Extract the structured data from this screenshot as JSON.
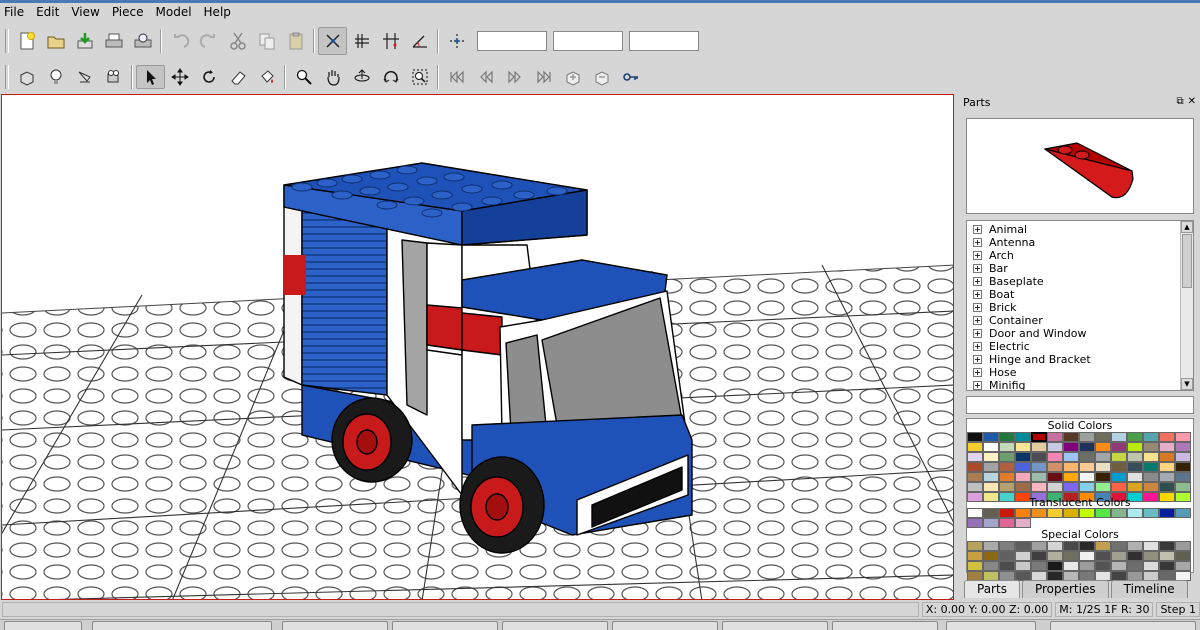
{
  "menu": [
    "File",
    "Edit",
    "View",
    "Piece",
    "Model",
    "Help"
  ],
  "toolbar1": {
    "buttons": [
      "new-icon",
      "open-icon",
      "save-icon",
      "print-icon",
      "print-preview-icon",
      "undo-icon",
      "redo-icon",
      "cut-icon",
      "copy-icon",
      "paste-icon",
      "snap-xy-icon",
      "snap-z-icon",
      "snap-grid-icon",
      "snap-angle-icon",
      "lock-icon"
    ],
    "coord_x": "",
    "coord_y": "",
    "coord_z": ""
  },
  "toolbar2": {
    "buttons": [
      "new-piece-icon",
      "light-icon",
      "spotlight-icon",
      "camera-icon",
      "select-icon",
      "move-icon",
      "rotate-icon",
      "erase-icon",
      "paint-icon",
      "zoom-icon",
      "pan-icon",
      "orbit-icon",
      "roll-icon",
      "zoom-region-icon",
      "first-step-icon",
      "previous-step-icon",
      "next-step-icon",
      "last-step-icon",
      "insert-step-icon",
      "remove-step-icon",
      "key-icon"
    ]
  },
  "parts_panel": {
    "title": "Parts",
    "categories": [
      "Animal",
      "Antenna",
      "Arch",
      "Bar",
      "Baseplate",
      "Boat",
      "Brick",
      "Container",
      "Door and Window",
      "Electric",
      "Hinge and Bracket",
      "Hose",
      "Minifig"
    ],
    "search_value": "",
    "solid_colors_label": "Solid Colors",
    "translucent_colors_label": "Translucent Colors",
    "special_colors_label": "Special Colors",
    "solid_colors": [
      "#101010",
      "#1e5aa8",
      "#237841",
      "#008b9a",
      "#b40000",
      "#c870a0",
      "#583927",
      "#9ba19d",
      "#6d6e5c",
      "#b4d2e3",
      "#4b9f4a",
      "#55a5af",
      "#f2705e",
      "#fc97ac",
      "#f5cd2f",
      "#ffffff",
      "#c2dab8",
      "#fbe696",
      "#e4cd9e",
      "#c9cae2",
      "#81007b",
      "#20325b",
      "#fe8a18",
      "#923978",
      "#bbe90b",
      "#958a73",
      "#e4adc8",
      "#ac78ba",
      "#e1d5ed",
      "#fff1c4",
      "#6e9d6e",
      "#0a3463",
      "#4d4c52",
      "#f785b1",
      "#9dc3f7",
      "#6c6e68",
      "#a0a5a9",
      "#c5d640",
      "#bdc6ad",
      "#f7e38f",
      "#d67923",
      "#cbb9e1",
      "#ac4a2c",
      "#a3a2a4",
      "#ad6140",
      "#4c61db",
      "#7396c8",
      "#d09168",
      "#fcb76d",
      "#ffc995",
      "#eadec3",
      "#705e3f",
      "#354e5a",
      "#0b7a6e",
      "#ffd67f",
      "#352100",
      "#aa7d55",
      "#b8d4e0",
      "#e07d2d",
      "#f6a9bb",
      "#a0bcac",
      "#6a0e15",
      "#ffa70b",
      "#f2f3f2",
      "#372100",
      "#009ece",
      "#e0e0e0",
      "#8a8a8a",
      "#a5a9b4",
      "#5e748c",
      "#c0c0c0",
      "#ffe6b4",
      "#b4a16e",
      "#9c6c48",
      "#ffb6c1",
      "#d3d3d3",
      "#7b68ee",
      "#87ceeb",
      "#90ee90",
      "#ff6347",
      "#daa520",
      "#cd853f",
      "#2f4f4f",
      "#8fbc8f",
      "#dda0dd",
      "#f0e68c",
      "#48d1cc",
      "#ff4500",
      "#9370db",
      "#3cb371",
      "#b22222",
      "#ff8c00",
      "#4682b4",
      "#dc143c",
      "#00ced1",
      "#ff1493",
      "#ffd700",
      "#adff2f"
    ],
    "translucent_colors": [
      "#fcfcfc",
      "#635f52",
      "#c91a09",
      "#ff800d",
      "#f08f1c",
      "#f5cd2f",
      "#dab000",
      "#c0ff00",
      "#56e646",
      "#84b68d",
      "#aee9ef",
      "#68bcc5",
      "#0020a0",
      "#559ab7",
      "#9670b8",
      "#a5a5cb",
      "#df6695",
      "#e4adc8"
    ],
    "special_colors": [
      "#b8a35c",
      "#aaaaaa",
      "#7e7e7e",
      "#5e5e5e",
      "#a0a0a0",
      "#d4d4d4",
      "#4a4a4a",
      "#2a2a2a",
      "#c0a050",
      "#707070",
      "#b0b0b0",
      "#e0e0e0",
      "#3a3a3a",
      "#9a9a9a",
      "#c8a040",
      "#8b6914",
      "#606060",
      "#d0d0d0",
      "#404040",
      "#b0b0a0",
      "#707060",
      "#f0f0f0",
      "#505050",
      "#a0a090",
      "#303030",
      "#909080",
      "#c0c0b0",
      "#606050",
      "#d2c040",
      "#888888",
      "#4c4c4c",
      "#c8c8c8",
      "#7a7a7a",
      "#1a1a1a",
      "#e8e8e8",
      "#9c9c9c",
      "#545454",
      "#b4b4b4",
      "#6e6e6e",
      "#dcdcdc",
      "#383838",
      "#a8a8a8",
      "#a08040",
      "#c0c060",
      "#909090",
      "#585858",
      "#d8d8d8",
      "#282828",
      "#b8b8b8",
      "#787878",
      "#e4e4e4",
      "#444444",
      "#989898",
      "#cccccc",
      "#686868",
      "#f4f4f4"
    ],
    "tabs": [
      "Parts",
      "Properties",
      "Timeline"
    ],
    "active_tab": "Parts"
  },
  "status": {
    "message": "",
    "xyz": "X: 0.00 Y: 0.00 Z: 0.00",
    "snap": "M: 1/2S 1F R: 30",
    "step": "Step 1"
  }
}
